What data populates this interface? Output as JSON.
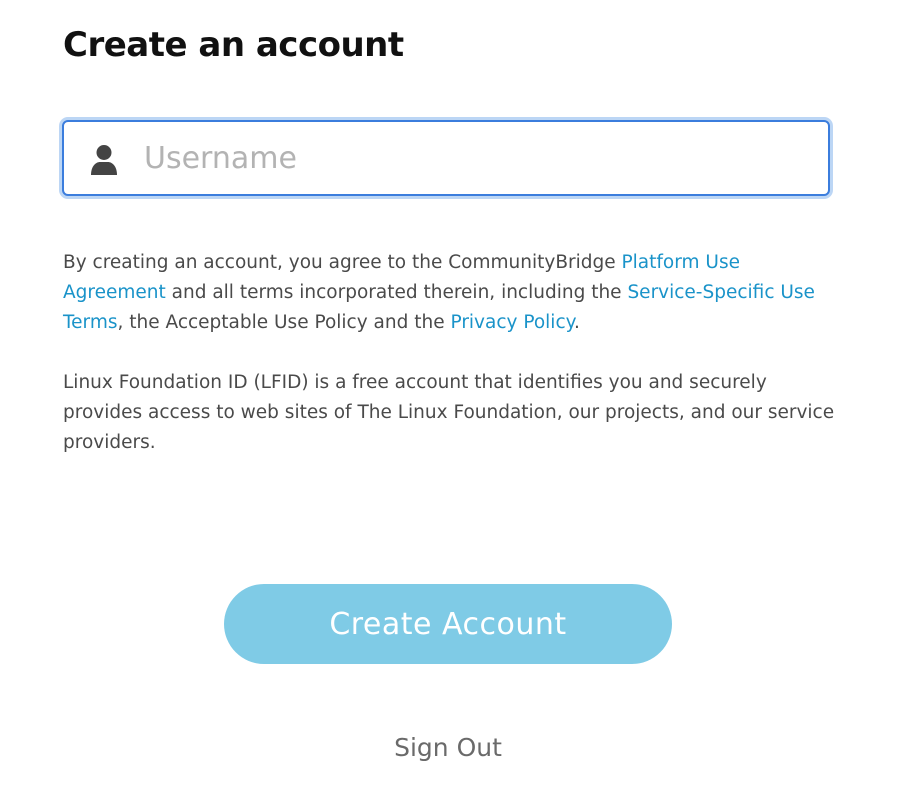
{
  "page": {
    "title": "Create an account"
  },
  "form": {
    "username_placeholder": "Username",
    "username_value": "",
    "username_icon": "user-icon"
  },
  "terms": {
    "text_1": "By creating an account, you agree to the CommunityBridge ",
    "link_platform_use": "Platform Use Agreement",
    "text_2": " and all terms incorporated therein, including the ",
    "link_service_terms": "Service-Specific Use Terms",
    "text_3": ", the Acceptable Use Policy and the ",
    "link_privacy": "Privacy Policy",
    "text_4": "."
  },
  "about": {
    "text": "Linux Foundation ID (LFID) is a free account that identifies you and securely provides access to web sites of The Linux Foundation, our projects, and our service providers."
  },
  "actions": {
    "create_label": "Create Account",
    "sign_out_label": "Sign Out"
  },
  "colors": {
    "focus_border": "#3b7ddd",
    "link": "#1a93c9",
    "button_bg": "#7fcbe6",
    "button_text": "#ffffff",
    "body_text": "#4a4a4a",
    "title_text": "#111111"
  }
}
